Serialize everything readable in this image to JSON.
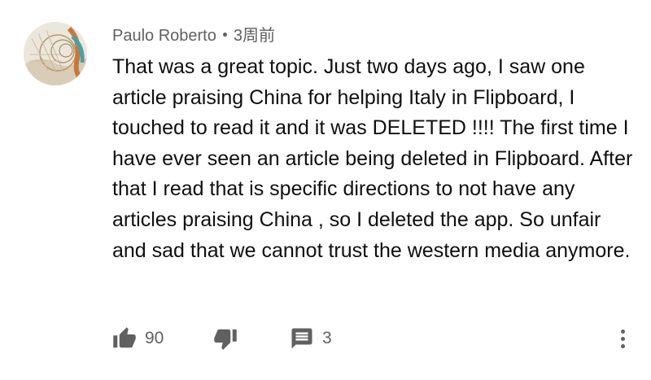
{
  "comment": {
    "author": "Paulo Roberto",
    "time_ago": "3周前",
    "text": "That was a great topic. Just two days ago, I saw one article praising China for helping Italy in Flipboard, I touched to read it and it was DELETED !!!! The first time I have ever seen an article being deleted in Flipboard. After that I read that is specific directions to not have any articles praising China , so I deleted the app. So unfair and sad that we cannot trust the western media anymore.",
    "like_count": "90",
    "reply_count": "3"
  },
  "icons": {
    "like": "thumbs-up-icon",
    "dislike": "thumbs-down-icon",
    "reply": "comment-icon",
    "more": "more-vertical-icon"
  },
  "colors": {
    "text": "#0f0f0f",
    "secondary": "#606060",
    "icon": "#606060",
    "background": "#ffffff"
  }
}
